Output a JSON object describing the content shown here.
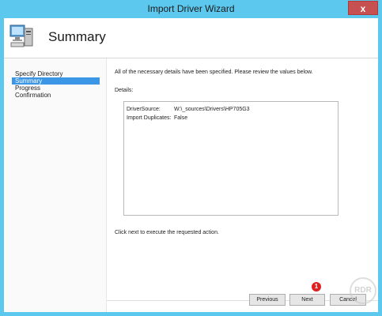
{
  "window": {
    "title": "Import Driver Wizard",
    "close_glyph": "x"
  },
  "header": {
    "title": "Summary",
    "icon": "computer-icon"
  },
  "nav": {
    "items": [
      {
        "label": "Specify Directory",
        "active": false
      },
      {
        "label": "Summary",
        "active": true
      },
      {
        "label": "Progress",
        "active": false
      },
      {
        "label": "Confirmation",
        "active": false
      }
    ]
  },
  "main": {
    "intro": "All of the necessary details have been specified.  Please review the values below.",
    "details_label": "Details:",
    "details": [
      {
        "key": "DriverSource:",
        "value": "W:\\_sources\\Drivers\\HP705G3"
      },
      {
        "key": "Import Duplicates:",
        "value": "False"
      }
    ],
    "footer_message": "Click next to execute the requested action."
  },
  "buttons": {
    "previous": "Previous",
    "next": "Next",
    "cancel": "Cancel"
  },
  "annotation": {
    "badge": "1"
  },
  "watermark": {
    "text": "RDR"
  },
  "colors": {
    "title_bar": "#5cc8ee",
    "close": "#c75050",
    "nav_selected": "#3c96e6",
    "badge": "#e02020"
  }
}
